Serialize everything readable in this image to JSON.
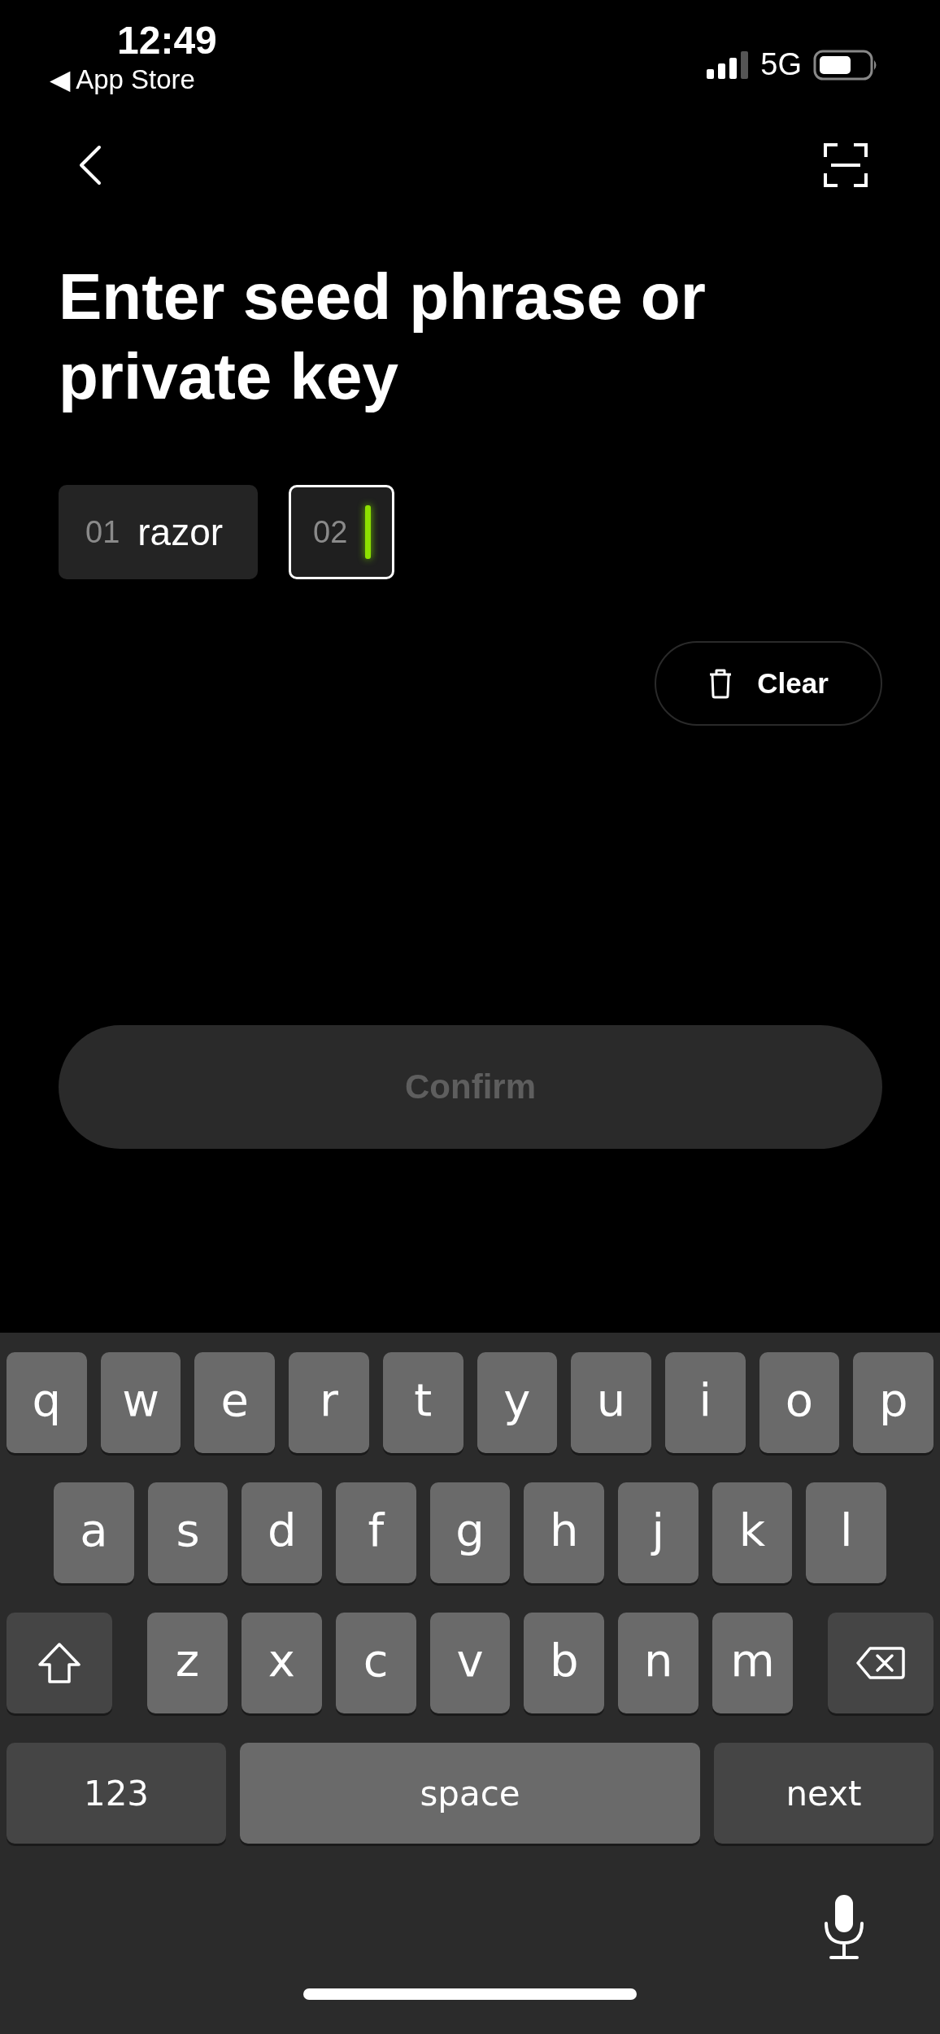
{
  "status_bar": {
    "time": "12:49",
    "back_app": "◀ App Store",
    "network": "5G"
  },
  "title": "Enter seed phrase or private key",
  "words": [
    {
      "index": "01",
      "word": "razor",
      "focused": false
    },
    {
      "index": "02",
      "focused": true
    }
  ],
  "clear_button": {
    "label": "Clear"
  },
  "confirm_button": {
    "label": "Confirm",
    "disabled": true
  },
  "keyboard": {
    "rows": [
      {
        "keys": [
          {
            "kind": "letter",
            "label": "q"
          },
          {
            "kind": "letter",
            "label": "w"
          },
          {
            "kind": "letter",
            "label": "e"
          },
          {
            "kind": "letter",
            "label": "r"
          },
          {
            "kind": "letter",
            "label": "t"
          },
          {
            "kind": "letter",
            "label": "y"
          },
          {
            "kind": "letter",
            "label": "u"
          },
          {
            "kind": "letter",
            "label": "i"
          },
          {
            "kind": "letter",
            "label": "o"
          },
          {
            "kind": "letter",
            "label": "p"
          }
        ]
      },
      {
        "keys": [
          {
            "kind": "letter",
            "label": "a"
          },
          {
            "kind": "letter",
            "label": "s"
          },
          {
            "kind": "letter",
            "label": "d"
          },
          {
            "kind": "letter",
            "label": "f"
          },
          {
            "kind": "letter",
            "label": "g"
          },
          {
            "kind": "letter",
            "label": "h"
          },
          {
            "kind": "letter",
            "label": "j"
          },
          {
            "kind": "letter",
            "label": "k"
          },
          {
            "kind": "letter",
            "label": "l"
          }
        ]
      },
      {
        "keys": [
          {
            "kind": "shift"
          },
          {
            "kind": "letter",
            "label": "z"
          },
          {
            "kind": "letter",
            "label": "x"
          },
          {
            "kind": "letter",
            "label": "c"
          },
          {
            "kind": "letter",
            "label": "v"
          },
          {
            "kind": "letter",
            "label": "b"
          },
          {
            "kind": "letter",
            "label": "n"
          },
          {
            "kind": "letter",
            "label": "m"
          },
          {
            "kind": "backspace"
          }
        ]
      },
      {
        "keys": [
          {
            "kind": "numbers",
            "label": "123"
          },
          {
            "kind": "space",
            "label": "space"
          },
          {
            "kind": "return",
            "label": "next"
          }
        ]
      }
    ]
  }
}
